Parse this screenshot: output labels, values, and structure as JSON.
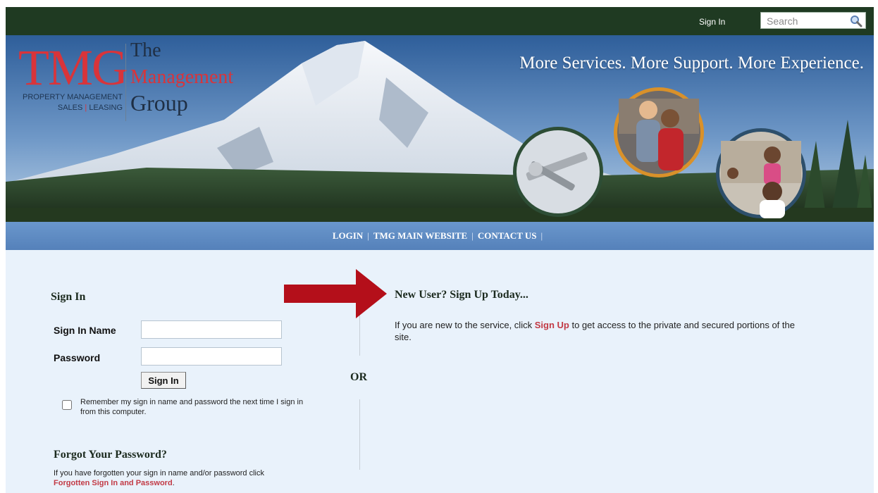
{
  "topbar": {
    "signin_label": "Sign In",
    "search_placeholder": "Search"
  },
  "banner": {
    "logo_abbr": "TMG",
    "logo_line1": "The",
    "logo_line2": "Management",
    "logo_line3": "Group",
    "logo_sub1": "PROPERTY MANAGEMENT",
    "logo_sub2_a": "SALES",
    "logo_sub2_sep": "|",
    "logo_sub2_b": "LEASING",
    "tagline": "More Services. More Support. More Experience."
  },
  "nav": {
    "items": [
      {
        "label": "LOGIN"
      },
      {
        "label": "TMG MAIN WEBSITE"
      },
      {
        "label": "CONTACT US"
      }
    ],
    "separator": "|"
  },
  "signin": {
    "title": "Sign In",
    "name_label": "Sign In Name",
    "password_label": "Password",
    "button_label": "Sign In",
    "remember_text": "Remember my sign in name and password the next time I sign in from this computer."
  },
  "forgot": {
    "title": "Forgot Your Password?",
    "text": "If you have forgotten your sign in name and/or password click",
    "link": "Forgotten Sign In and Password",
    "suffix": "."
  },
  "divider": {
    "or_label": "OR"
  },
  "newuser": {
    "title": "New User? Sign Up Today...",
    "text_before": "If you are new to the service, click",
    "link": "Sign Up",
    "text_after": "to get access to the private and secured portions of the site."
  },
  "colors": {
    "topbar": "#1f3a22",
    "brand_red": "#d9343a",
    "nav_blue": "#5f8cc4",
    "page_bg": "#e9f2fb",
    "arrow": "#b40f1a",
    "link": "#c23a45"
  }
}
